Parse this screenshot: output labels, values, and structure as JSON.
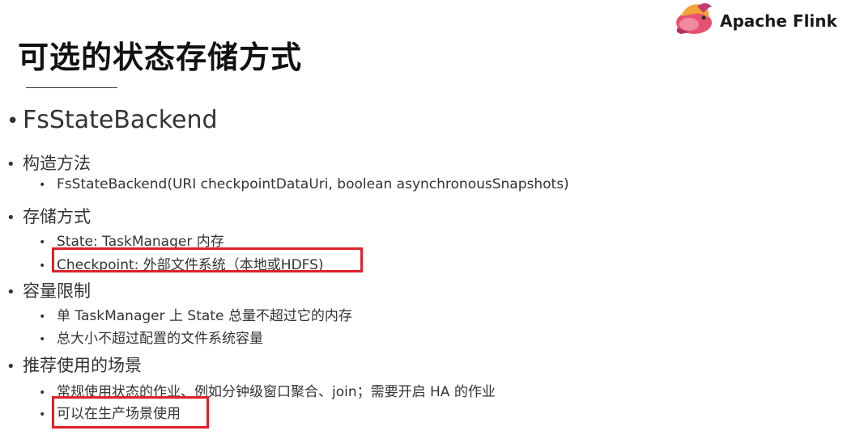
{
  "brand": {
    "name": "Apache Flink",
    "accent": "#e6526f"
  },
  "slide": {
    "title": "可选的状态存储方式",
    "main_bullet": "FsStateBackend",
    "sections": [
      {
        "label": "构造方法",
        "items": [
          "FsStateBackend(URI checkpointDataUri, boolean asynchronousSnapshots)"
        ]
      },
      {
        "label": "存储方式",
        "items": [
          "State: TaskManager 内存",
          "Checkpoint: 外部文件系统（本地或HDFS)"
        ]
      },
      {
        "label": "容量限制",
        "items": [
          "单 TaskManager 上 State 总量不超过它的内存",
          "总大小不超过配置的文件系统容量"
        ]
      },
      {
        "label": "推荐使用的场景",
        "items": [
          "常规使用状态的作业、例如分钟级窗口聚合、join；需要开启 HA 的作业",
          "可以在生产场景使用"
        ]
      }
    ],
    "bullet_glyph": "•",
    "highlight_color": "#e0202a"
  }
}
